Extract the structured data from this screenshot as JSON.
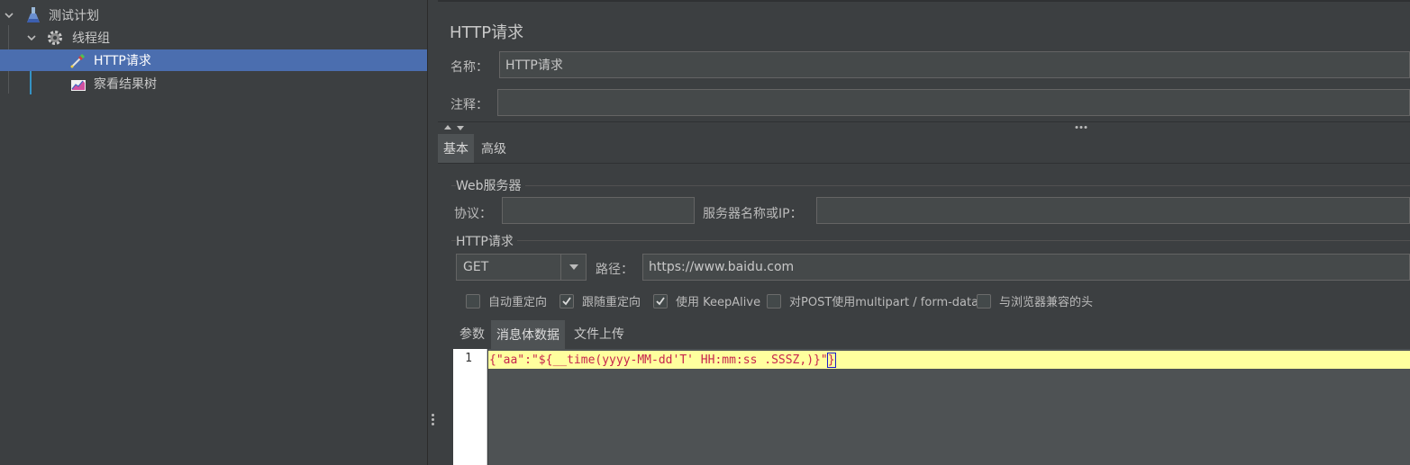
{
  "tree": {
    "items": [
      {
        "label": "测试计划",
        "icon": "flask-icon"
      },
      {
        "label": "线程组",
        "icon": "gear-icon"
      },
      {
        "label": "HTTP请求",
        "icon": "pipette-icon",
        "selected": true
      },
      {
        "label": "察看结果树",
        "icon": "chart-icon"
      }
    ]
  },
  "panel": {
    "title": "HTTP请求",
    "name_label": "名称：",
    "name_value": "HTTP请求",
    "comment_label": "注释：",
    "comment_value": "",
    "tabs": [
      {
        "label": "基本",
        "active": true
      },
      {
        "label": "高级",
        "active": false
      }
    ],
    "web_server": {
      "title": "Web服务器",
      "protocol_label": "协议：",
      "protocol_value": "",
      "server_label": "服务器名称或IP：",
      "server_value": ""
    },
    "http_request": {
      "title": "HTTP请求",
      "method": "GET",
      "path_label": "路径：",
      "path_value": "https://www.baidu.com"
    },
    "checkboxes": [
      {
        "label": "自动重定向",
        "checked": false
      },
      {
        "label": "跟随重定向",
        "checked": true
      },
      {
        "label": "使用 KeepAlive",
        "checked": true
      },
      {
        "label": "对POST使用multipart / form-data",
        "checked": false
      },
      {
        "label": "与浏览器兼容的头",
        "checked": false
      }
    ],
    "sub_tabs": [
      {
        "label": "参数",
        "active": false
      },
      {
        "label": "消息体数据",
        "active": true
      },
      {
        "label": "文件上传",
        "active": false
      }
    ],
    "editor": {
      "line_number": "1",
      "code_main": "{\"aa\":\"${__time(yyyy-MM-dd'T' HH:mm:ss .SSSZ,)}\"",
      "code_last": "}"
    }
  },
  "colors": {
    "selection": "#4b6eaf",
    "background": "#3c3f41",
    "code_highlight": "#ffff9e",
    "code_text": "#c7254e"
  }
}
